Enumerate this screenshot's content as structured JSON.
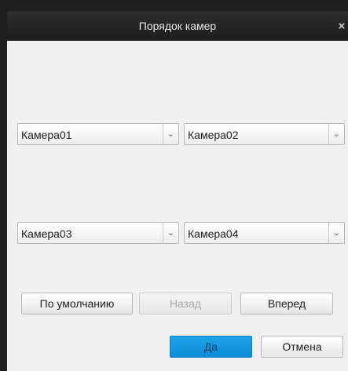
{
  "dialog": {
    "title": "Порядок камер",
    "close_glyph": "×"
  },
  "selectors": [
    {
      "value": "Камера01"
    },
    {
      "value": "Камера02"
    },
    {
      "value": "Камера03"
    },
    {
      "value": "Камера04"
    }
  ],
  "nav": {
    "default_label": "По умолчанию",
    "back_label": "Назад",
    "forward_label": "Вперед"
  },
  "footer": {
    "ok_label": "Да",
    "cancel_label": "Отмена"
  },
  "colors": {
    "titlebar": "#1d1d1d",
    "body": "#f0f0f0",
    "primary_button": "#1ea4ea"
  }
}
